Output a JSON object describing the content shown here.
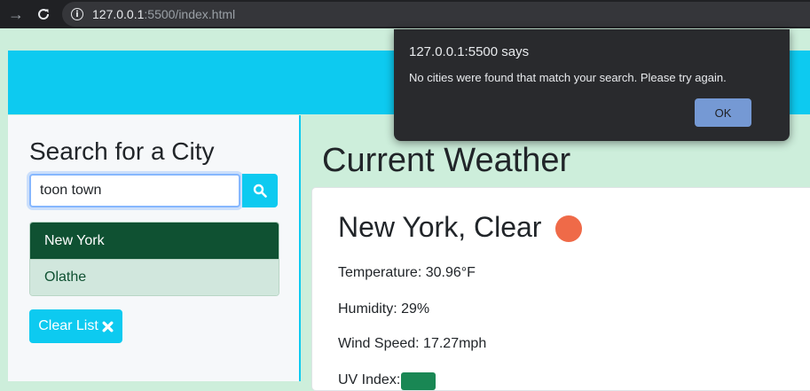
{
  "browser": {
    "url_host": "127.0.0.1",
    "url_rest": ":5500/index.html"
  },
  "sidebar": {
    "heading": "Search for a City",
    "search_value": "toon town",
    "cities": [
      {
        "label": "New York",
        "active": true
      },
      {
        "label": "Olathe",
        "active": false
      }
    ],
    "clear_label": "Clear List"
  },
  "main": {
    "title": "Current Weather",
    "city_heading": "New York, Clear",
    "temperature": "Temperature: 30.96°F",
    "humidity": "Humidity: 29%",
    "wind": "Wind Speed: 17.27mph",
    "uv_label": "UV Index:"
  },
  "dialog": {
    "title": "127.0.0.1:5500 says",
    "message": "No cities were found that match your search. Please try again.",
    "ok_label": "OK"
  },
  "colors": {
    "accent": "#0dcaf0",
    "active_city": "#0f5132",
    "inactive_city": "#d1e7dd",
    "weather_icon": "#ef6a48",
    "uv_badge": "#198754"
  }
}
